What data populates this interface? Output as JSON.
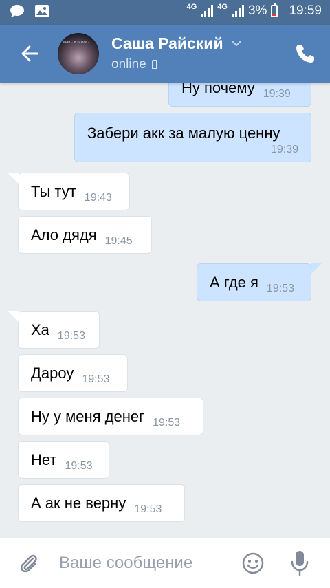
{
  "status_bar": {
    "network_1": "4G",
    "network_2": "4G",
    "battery": "3%",
    "time": "19:59",
    "icons": [
      "message-icon",
      "image-icon",
      "signal-icon",
      "battery-icon"
    ]
  },
  "header": {
    "contact_name": "Саша Райский",
    "status": "online",
    "avatar_caption": "ашот, я готов..",
    "icons": [
      "back-arrow-icon",
      "chevron-down-icon",
      "mobile-phone-icon",
      "call-icon"
    ],
    "colors": {
      "header": "#5181b8",
      "statusbar": "#4a6e95"
    }
  },
  "messages": [
    {
      "direction": "out",
      "text": "Ну почему",
      "time": "19:39"
    },
    {
      "direction": "out",
      "text": "Забери акк за малую ценну",
      "time": "19:39"
    },
    {
      "direction": "in",
      "text": "Ты тут",
      "time": "19:43"
    },
    {
      "direction": "in",
      "text": "Ало дядя",
      "time": "19:45"
    },
    {
      "direction": "out",
      "text": "А где я",
      "time": "19:53"
    },
    {
      "direction": "in",
      "text": "Ха",
      "time": "19:53"
    },
    {
      "direction": "in",
      "text": "Дароу",
      "time": "19:53"
    },
    {
      "direction": "in",
      "text": "Ну у меня денег",
      "time": "19:53"
    },
    {
      "direction": "in",
      "text": "Нет",
      "time": "19:53"
    },
    {
      "direction": "in",
      "text": "А ак не верну",
      "time": "19:53"
    }
  ],
  "input_bar": {
    "placeholder": "Ваше сообщение",
    "icons": [
      "paperclip-icon",
      "emoji-icon",
      "microphone-icon"
    ]
  },
  "colors": {
    "background": "#ebeef1",
    "incoming_bubble": "#ffffff",
    "outgoing_bubble": "#cce4ff",
    "time_text": "#8a96a3"
  }
}
